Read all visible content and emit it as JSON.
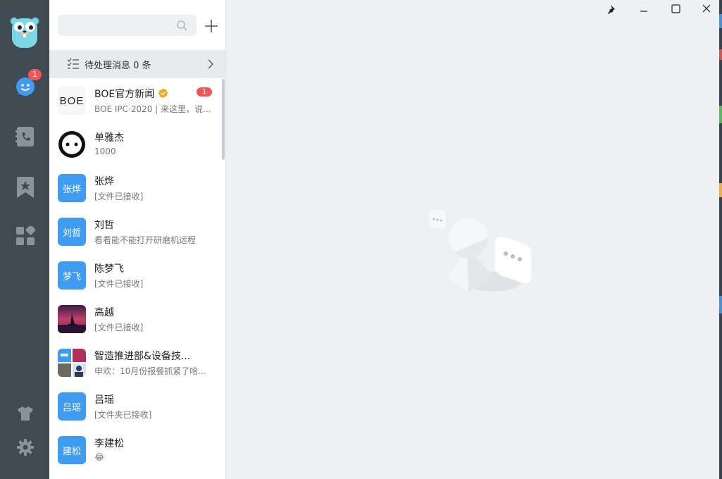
{
  "sidebar": {
    "app_icon": "gopher-avatar-icon",
    "items": [
      {
        "name": "chat-icon",
        "badge": "1"
      },
      {
        "name": "phone-contacts-icon"
      },
      {
        "name": "bookmark-star-icon"
      },
      {
        "name": "apps-grid-icon"
      },
      {
        "name": "tshirt-skin-icon"
      },
      {
        "name": "gear-icon"
      }
    ],
    "accent_color": "#3f9cf0",
    "background_color": "#3f4a53"
  },
  "search": {
    "placeholder": "",
    "value": ""
  },
  "pending": {
    "label": "待处理消息 0 条"
  },
  "conversations": [
    {
      "name": "BOE官方新闻",
      "preview": "BOE IPC·2020 | 来这里，说...",
      "badge": "1",
      "avatar_text": "BOE",
      "verified": true
    },
    {
      "name": "单雅杰",
      "preview": "1000",
      "avatar_text": ""
    },
    {
      "name": "张烨",
      "preview": "[文件已接收]",
      "avatar_text": "张烨"
    },
    {
      "name": "刘哲",
      "preview": "看看能不能打开研磨机远程",
      "avatar_text": "刘哲"
    },
    {
      "name": "陈梦飞",
      "preview": "[文件已接收]",
      "avatar_text": "梦飞"
    },
    {
      "name": "高越",
      "preview": "[文件已接收]",
      "avatar_text": ""
    },
    {
      "name": "智造推进部&设备技...",
      "preview": "申欢：10月份报餐抓紧了哈...",
      "avatar_text": ""
    },
    {
      "name": "吕瑶",
      "preview": "[文件夹已接收]",
      "avatar_text": "吕瑶"
    },
    {
      "name": "李建松",
      "preview": "😂",
      "avatar_text": "建松"
    }
  ],
  "window_controls": [
    "pin-icon",
    "minimize-icon",
    "maximize-icon",
    "close-icon"
  ]
}
